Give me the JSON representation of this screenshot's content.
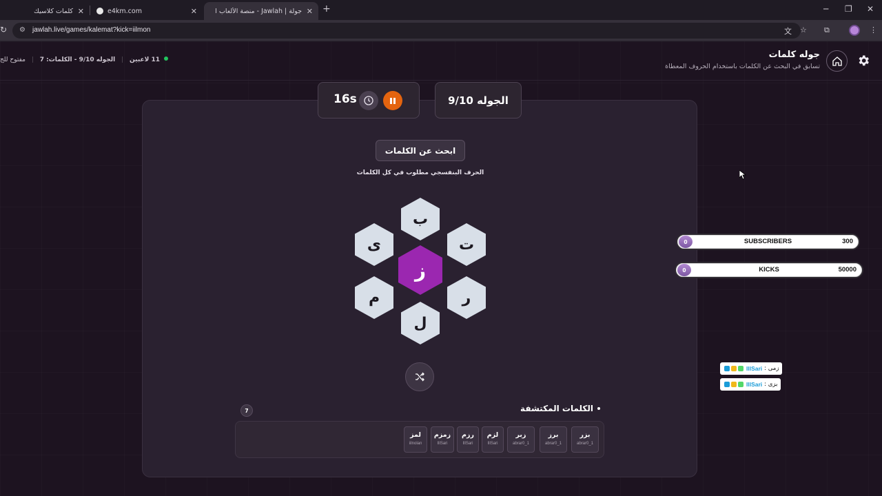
{
  "browser": {
    "tabs": [
      {
        "title": "كلمات كلاسيك"
      },
      {
        "title": "e4km.com"
      },
      {
        "title": "جولة | Jawlah - منصة الألعاب الـ"
      }
    ],
    "url": "jawlah.live/games/kalemat?kick=iilmon"
  },
  "header": {
    "title": "جوله كلمات",
    "subtitle": "تسابق في البحث عن الكلمات باستخدام الحروف المعطاة",
    "status": {
      "players": "11 لاعبين",
      "round_words": "الجوله 9/10 - الكلمات: 7",
      "open": "مفتوح للج"
    }
  },
  "round": {
    "label": "الجوله 9/10"
  },
  "timer": {
    "value": "16s"
  },
  "game": {
    "find_words_label": "ابحث عن الكلمات",
    "hint": "الحرف البنفسجي مطلوب في كل الكلمات",
    "letters": {
      "center": "ز",
      "top": "ب",
      "top_right": "ت",
      "bottom_right": "ر",
      "bottom": "ل",
      "bottom_left": "م",
      "top_left": "ى"
    },
    "found_title": "الكلمات المكتشفة",
    "found_count": "7",
    "found_words": [
      {
        "word": "بزر",
        "user": "abrar0_1"
      },
      {
        "word": "برز",
        "user": "abrar0_1"
      },
      {
        "word": "زبر",
        "user": "abrar0_1"
      },
      {
        "word": "لزم",
        "user": "IllSari"
      },
      {
        "word": "رزم",
        "user": "IllSari"
      },
      {
        "word": "زمزم",
        "user": "IllSari"
      },
      {
        "word": "لمز",
        "user": "iilnolan"
      }
    ]
  },
  "goals": [
    {
      "label": "SUBSCRIBERS",
      "current": "0",
      "goal": "300"
    },
    {
      "label": "KICKS",
      "current": "0",
      "goal": "50000"
    }
  ],
  "chat": [
    {
      "user": "IllSari",
      "message": "زمى :"
    },
    {
      "user": "IllSari",
      "message": "بزى :"
    }
  ],
  "colors": {
    "accent_purple": "#9b27b0",
    "pause_orange": "#e4640f",
    "online_green": "#22c55e"
  }
}
